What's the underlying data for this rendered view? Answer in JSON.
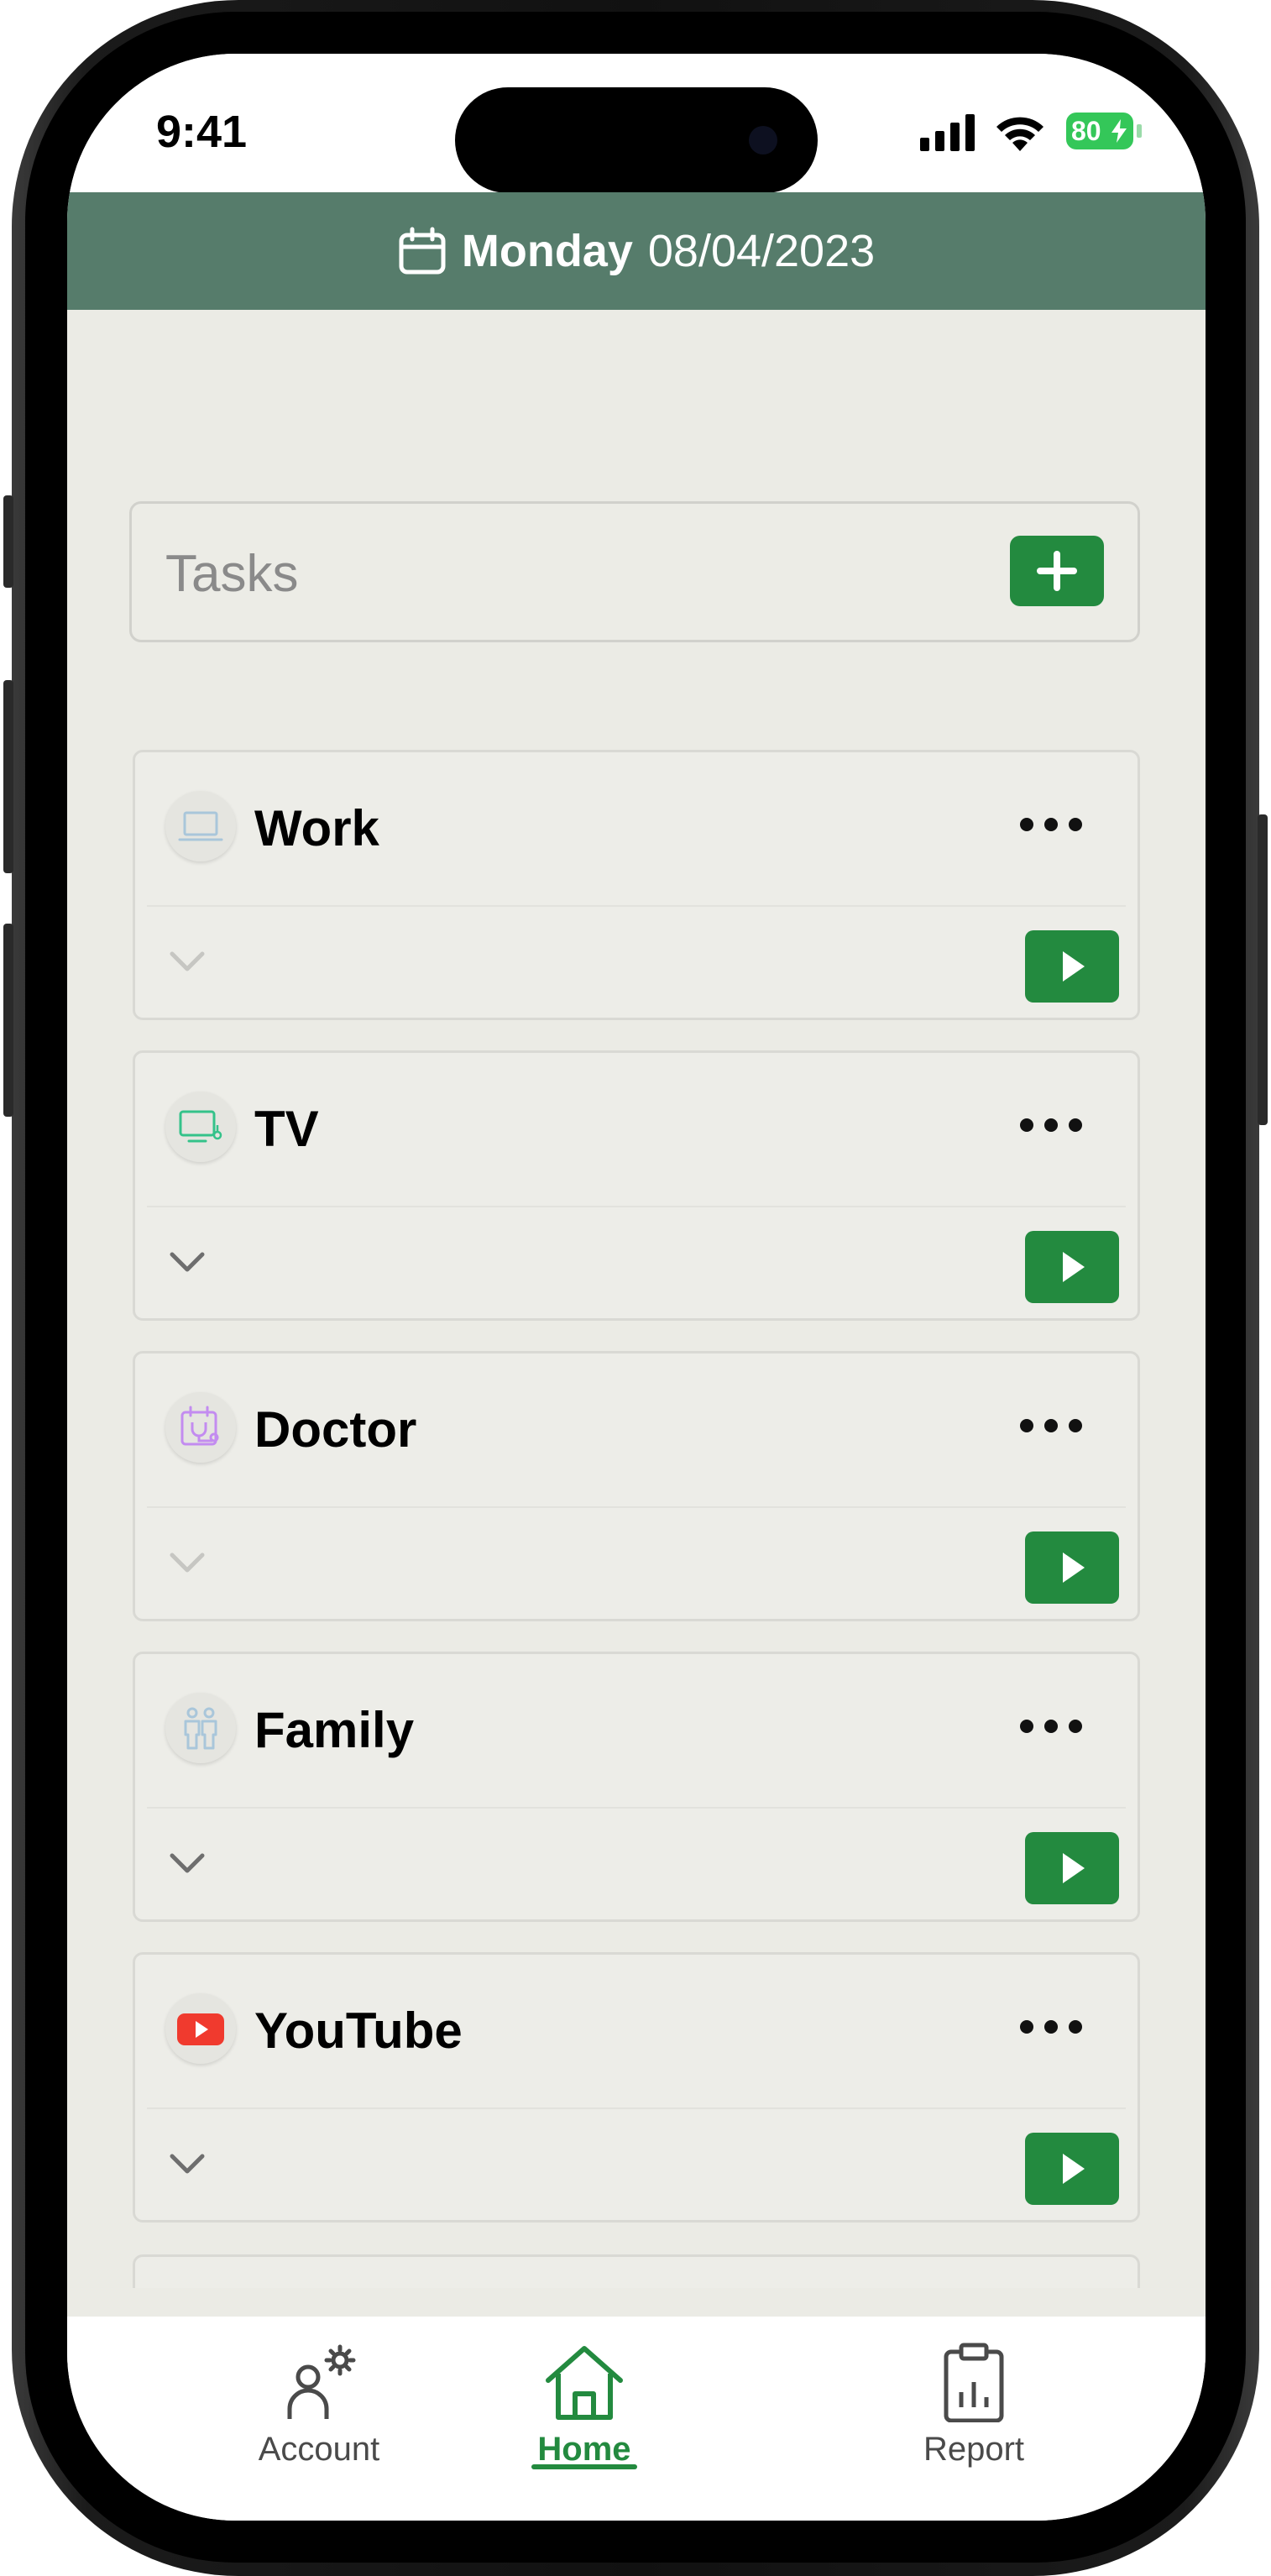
{
  "status_bar": {
    "time": "9:41",
    "battery": "80"
  },
  "header": {
    "calendar_icon": "calendar-icon",
    "day": "Monday",
    "date": "08/04/2023"
  },
  "tasks_bar": {
    "label": "Tasks",
    "add_icon": "plus-icon"
  },
  "cards": [
    {
      "title": "Work",
      "icon": "laptop-icon",
      "chevron_enabled": false
    },
    {
      "title": "TV",
      "icon": "tv-icon",
      "chevron_enabled": true
    },
    {
      "title": "Doctor",
      "icon": "medical-calendar-icon",
      "chevron_enabled": false
    },
    {
      "title": "Family",
      "icon": "family-icon",
      "chevron_enabled": true
    },
    {
      "title": "YouTube",
      "icon": "youtube-icon",
      "chevron_enabled": true
    }
  ],
  "tab_bar": {
    "tabs": [
      {
        "label": "Account",
        "icon": "account-settings-icon",
        "active": false
      },
      {
        "label": "Home",
        "icon": "home-icon",
        "active": true
      },
      {
        "label": "Report",
        "icon": "report-clipboard-icon",
        "active": false
      }
    ]
  },
  "colors": {
    "header_bg": "#567c6b",
    "accent_green": "#238a3f",
    "body_bg": "#ebebe5"
  }
}
